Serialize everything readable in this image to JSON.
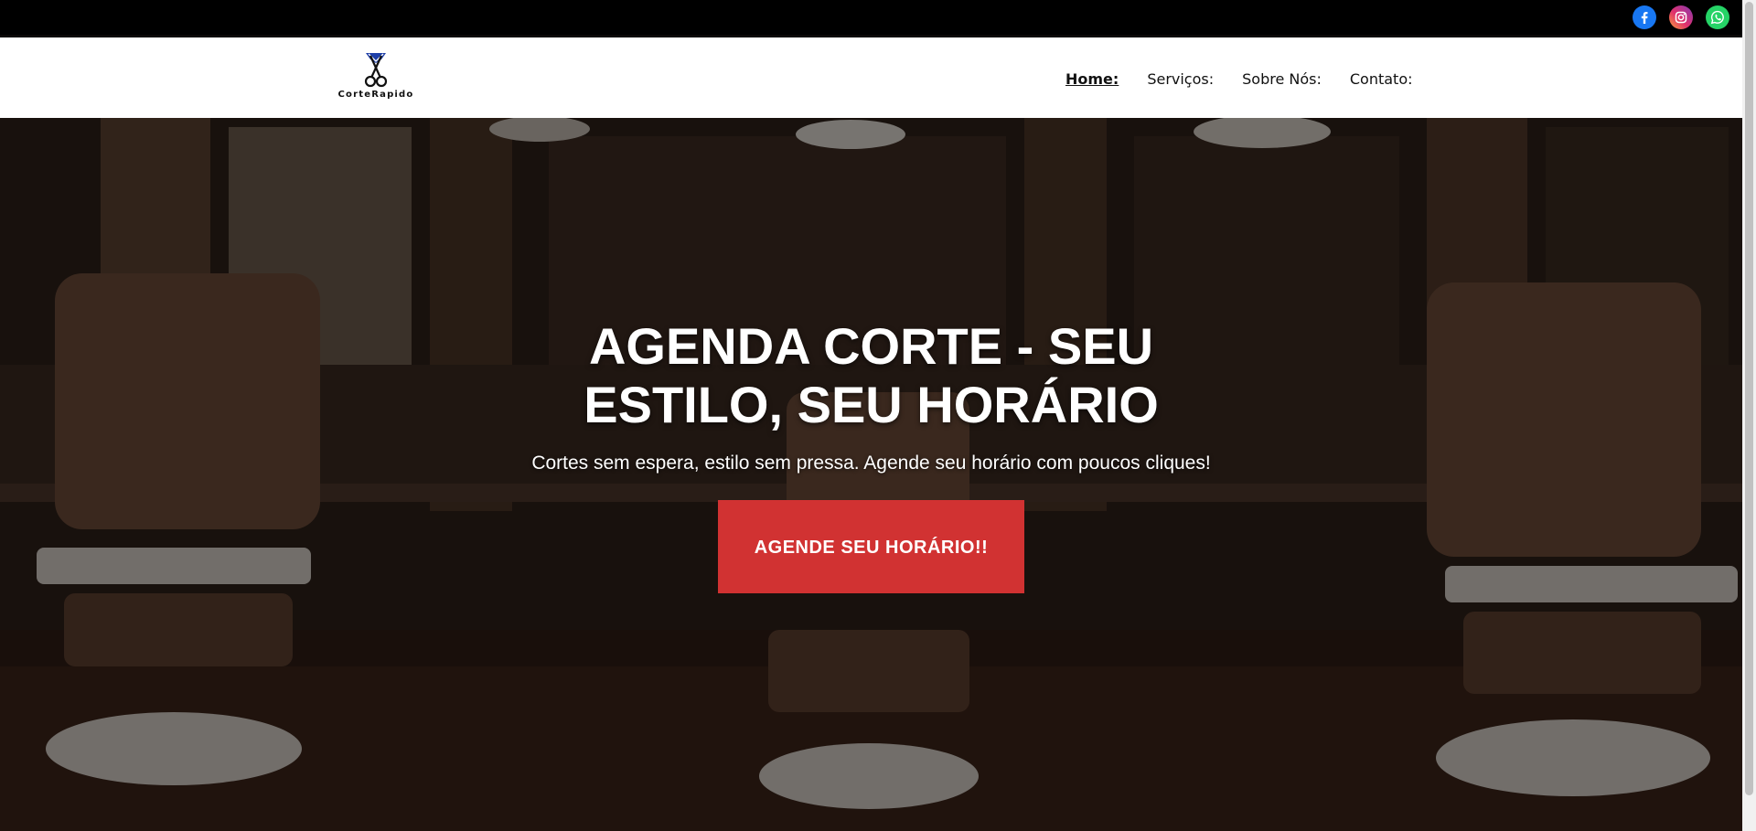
{
  "topbar": {
    "social": [
      {
        "name": "facebook",
        "icon": "facebook-icon",
        "color": "#1877f2"
      },
      {
        "name": "instagram",
        "icon": "instagram-icon",
        "color": "#e1306c"
      },
      {
        "name": "whatsapp",
        "icon": "whatsapp-icon",
        "color": "#25d366"
      }
    ]
  },
  "brand": {
    "name": "CorteRapido",
    "logo_icon": "scissors-icon"
  },
  "nav": {
    "items": [
      {
        "label": "Home:",
        "active": true
      },
      {
        "label": "Serviços:",
        "active": false
      },
      {
        "label": "Sobre Nós:",
        "active": false
      },
      {
        "label": "Contato:",
        "active": false
      }
    ]
  },
  "hero": {
    "title": "AGENDA CORTE - SEU ESTILO, SEU HORÁRIO",
    "subtitle": "Cortes sem espera, estilo sem pressa. Agende seu horário com poucos cliques!",
    "cta_label": "AGENDE SEU HORÁRIO!!",
    "background": "barbershop-interior-image"
  },
  "colors": {
    "topbar": "#000000",
    "navbar": "#ffffff",
    "cta": "#d13232",
    "hero_text": "#ffffff"
  }
}
